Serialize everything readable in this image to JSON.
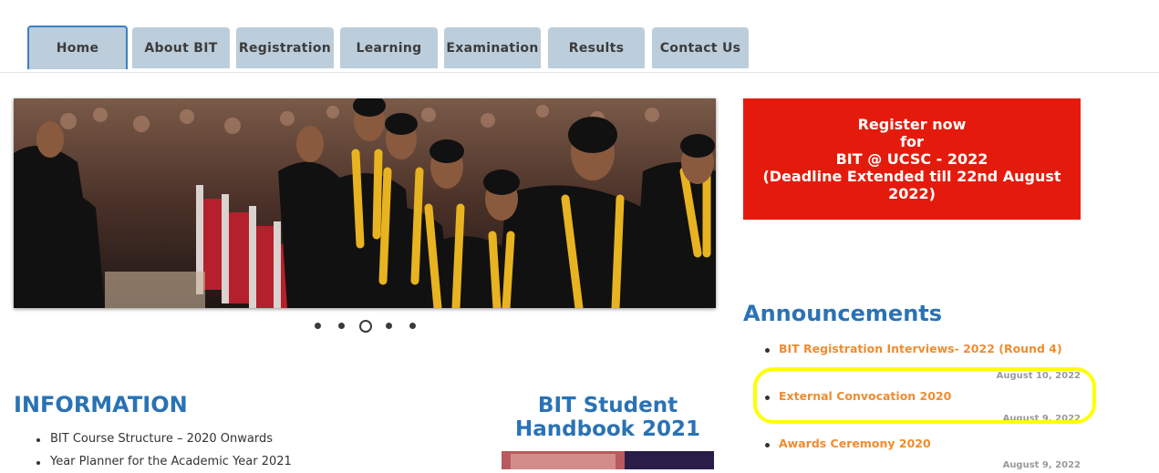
{
  "nav": {
    "tabs": [
      {
        "label": "Home",
        "active": true
      },
      {
        "label": "About BIT"
      },
      {
        "label": "Registration"
      },
      {
        "label": "Learning"
      },
      {
        "label": "Examination"
      },
      {
        "label": "Results"
      },
      {
        "label": "Contact Us"
      }
    ]
  },
  "slider": {
    "slide_count": 5,
    "active_slide": 3
  },
  "register": {
    "lines": [
      "Register now",
      "for",
      "BIT @ UCSC - 2022",
      "(Deadline Extended till 22nd August",
      "2022)"
    ]
  },
  "announcements": {
    "title": "Announcements",
    "items": [
      {
        "title": "BIT Registration Interviews- 2022 (Round 4)",
        "date": "August 10, 2022"
      },
      {
        "title": "External Convocation 2020",
        "date": "August 9, 2022"
      },
      {
        "title": "Awards Ceremony 2020",
        "date": "August 9, 2022"
      }
    ]
  },
  "information": {
    "title": "INFORMATION",
    "items": [
      "BIT Course Structure – 2020 Onwards",
      "Year Planner for the Academic Year 2021"
    ]
  },
  "handbook": {
    "title_line1": "BIT Student",
    "title_line2": "Handbook 2021"
  },
  "colors": {
    "accent_blue": "#2a72b5",
    "tab_bg": "#bccddb",
    "register_red": "#e41b0c",
    "announcement_link": "#f08c2e",
    "highlight": "#ffff00"
  }
}
